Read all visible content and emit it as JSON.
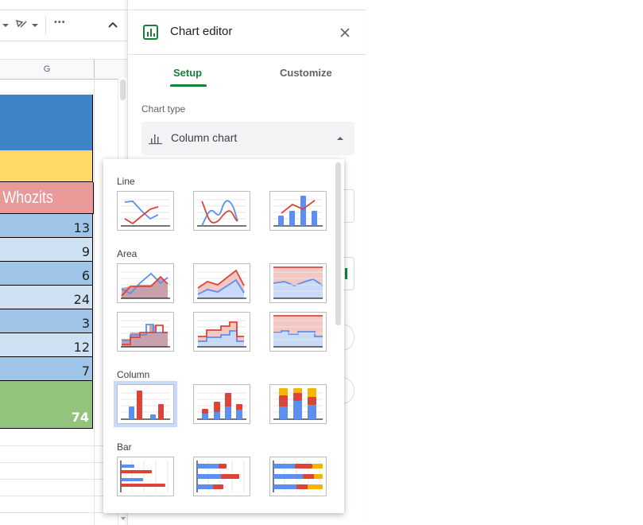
{
  "sheet": {
    "column_header": "G",
    "cells": [
      {
        "value": "",
        "bg": "#3d85c6",
        "text_color": "#ffffff"
      },
      {
        "value": "",
        "bg": "#ffd966",
        "text_color": "#000000"
      },
      {
        "value": "Whozits",
        "bg": "#ea9999",
        "text_color": "#ffffff"
      },
      {
        "value": "13",
        "bg": "#9fc5e8",
        "text_color": "#222222"
      },
      {
        "value": "9",
        "bg": "#cfe2f3",
        "text_color": "#222222"
      },
      {
        "value": "6",
        "bg": "#9fc5e8",
        "text_color": "#222222"
      },
      {
        "value": "24",
        "bg": "#cfe2f3",
        "text_color": "#222222"
      },
      {
        "value": "3",
        "bg": "#9fc5e8",
        "text_color": "#222222"
      },
      {
        "value": "12",
        "bg": "#cfe2f3",
        "text_color": "#222222"
      },
      {
        "value": "7",
        "bg": "#9fc5e8",
        "text_color": "#222222"
      },
      {
        "value": "74",
        "bg": "#93c47d",
        "text_color": "#ffffff"
      }
    ],
    "toolbar": {
      "more_label": "•••",
      "collapse_icon": "chevron-up-icon"
    }
  },
  "editor": {
    "title": "Chart editor",
    "close_icon": "close-icon",
    "tabs": [
      {
        "label": "Setup",
        "active": true
      },
      {
        "label": "Customize",
        "active": false
      }
    ],
    "chart_type_label": "Chart type",
    "chart_type_value": "Column chart",
    "accent": "#188038"
  },
  "chart_type_menu": {
    "sections": [
      {
        "label": "Line",
        "options": [
          "line-chart",
          "smooth-line-chart",
          "combo-chart"
        ]
      },
      {
        "label": "Area",
        "options": [
          "area-chart",
          "stacked-area-chart",
          "100-stacked-area-chart",
          "stepped-area-chart",
          "stacked-stepped-area-chart",
          "100-stacked-stepped-area-chart"
        ]
      },
      {
        "label": "Column",
        "options": [
          "column-chart",
          "stacked-column-chart",
          "100-stacked-column-chart"
        ],
        "selected": "column-chart"
      },
      {
        "label": "Bar",
        "options": [
          "bar-chart",
          "stacked-bar-chart",
          "100-stacked-bar-chart"
        ]
      }
    ],
    "colors": {
      "blue": "#5b8ff0",
      "red": "#db4437",
      "yellow": "#f4b400"
    }
  }
}
